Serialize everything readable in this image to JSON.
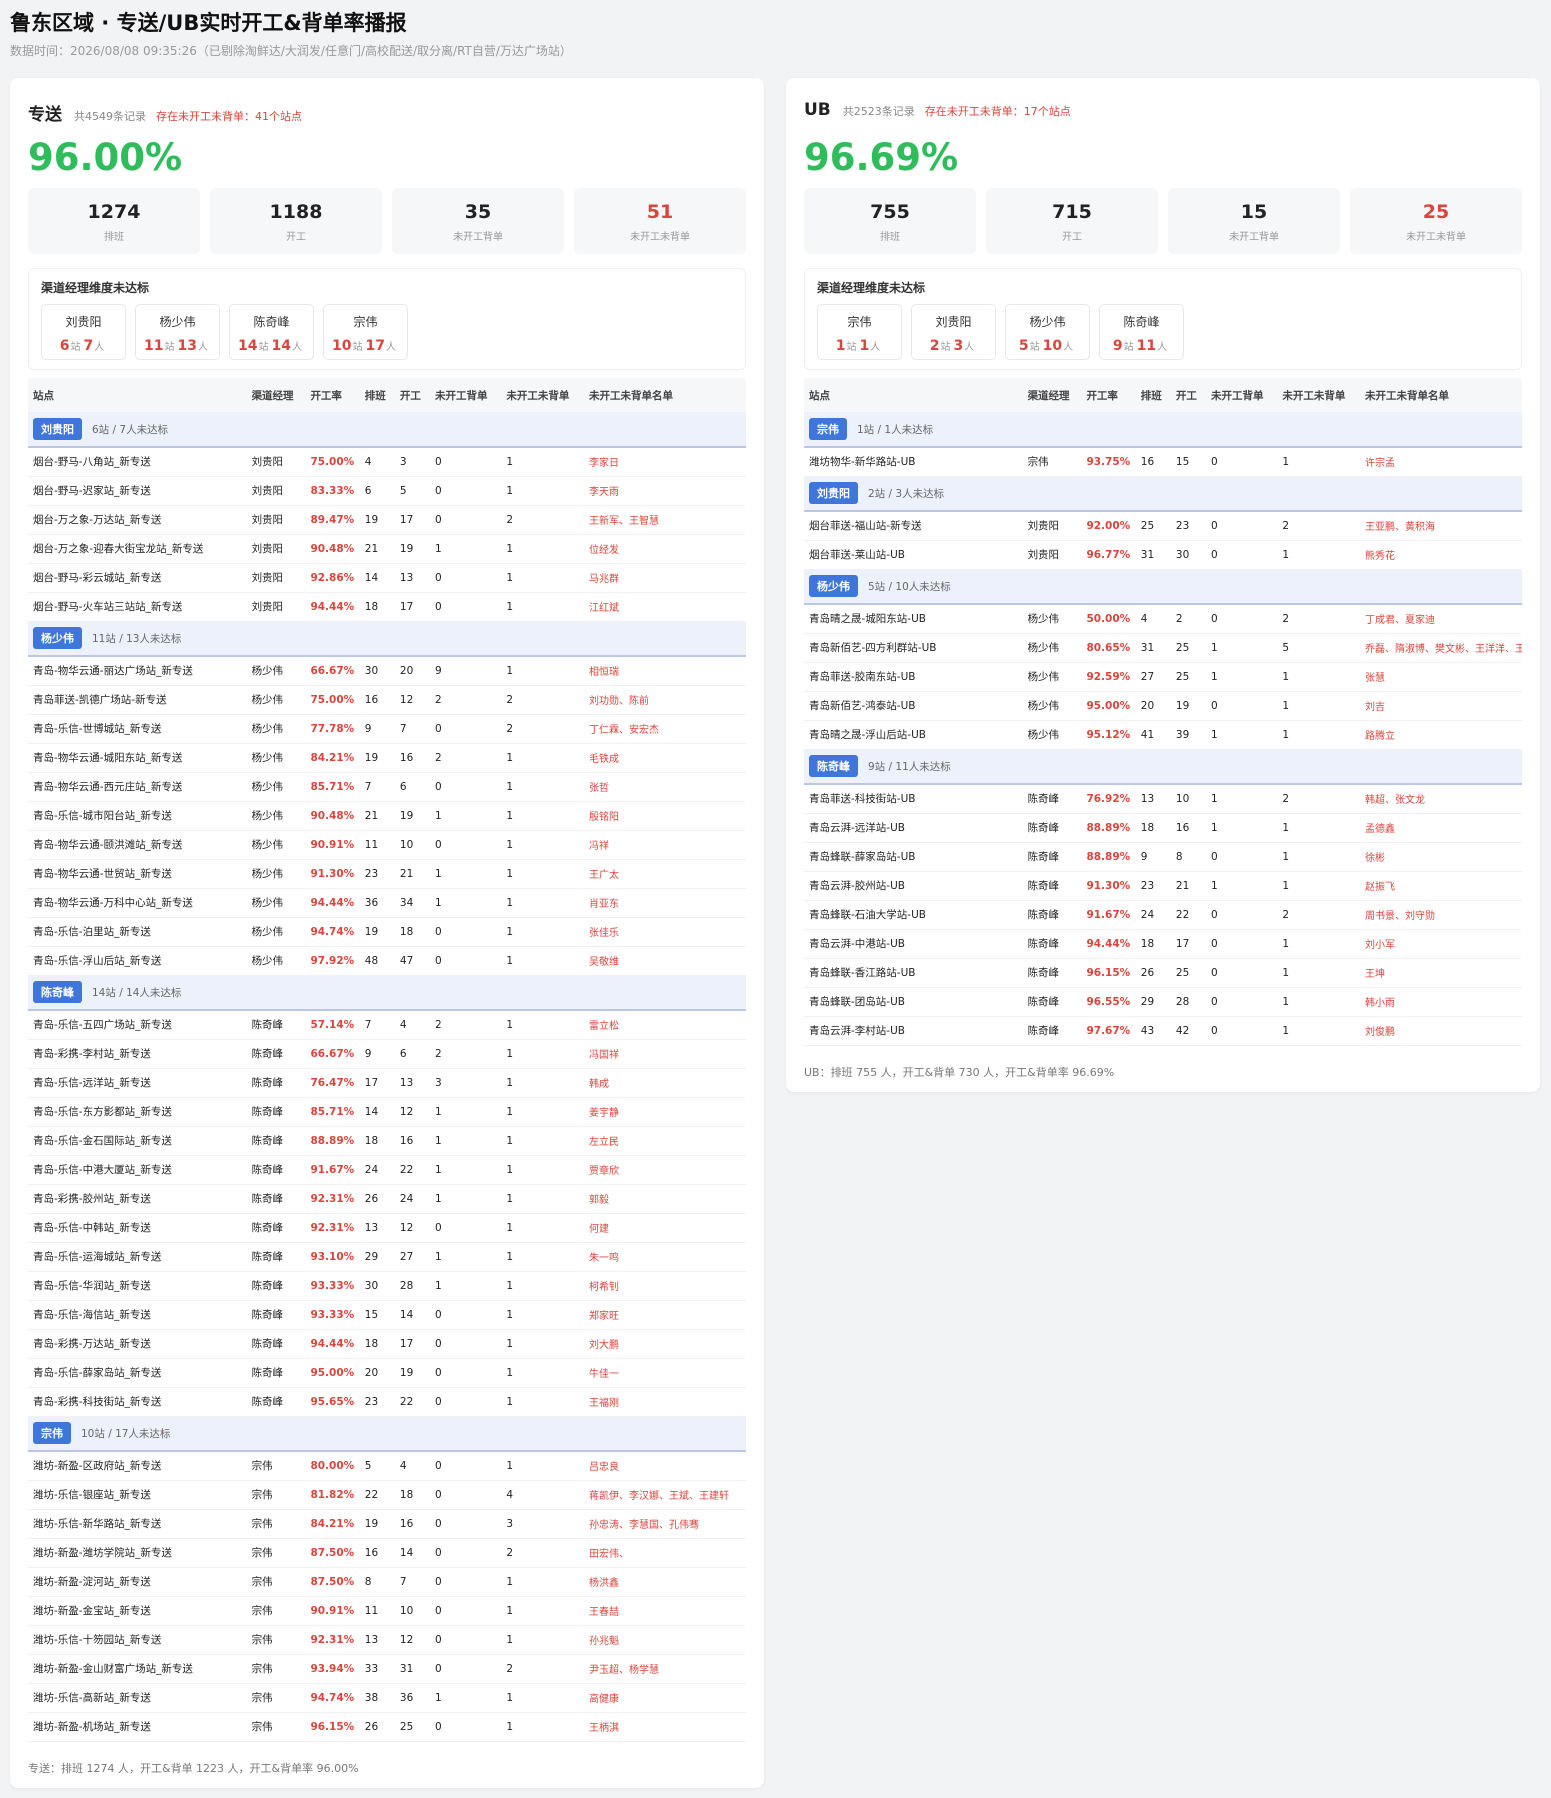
{
  "page": {
    "title": "鲁东区域 · 专送/UB实时开工&背单率播报",
    "subtitle": "数据时间：2026/08/08 09:35:26（已剔除淘鲜达/大润发/任意门/高校配送/取分离/RT自营/万达广场站）"
  },
  "columns": [
    "站点",
    "渠道经理",
    "开工率",
    "排班",
    "开工",
    "未开工背单",
    "未开工未背单",
    "未开工未背单名单"
  ],
  "mgr_box_title": "渠道经理维度未达标",
  "unit_station": "站",
  "unit_person": "人",
  "colors": {
    "accent": "#2fbc5a",
    "warn": "#d9453c",
    "tag": "#3f76d9"
  },
  "zs": {
    "name": "专送",
    "count": "共4549条记录",
    "warn": "存在未开工未背单：41个站点",
    "rate": "96.00%",
    "stats": [
      {
        "value": "1274",
        "label": "排班"
      },
      {
        "value": "1188",
        "label": "开工"
      },
      {
        "value": "35",
        "label": "未开工背单"
      },
      {
        "value": "51",
        "label": "未开工未背单"
      }
    ],
    "managers": [
      {
        "name": "刘贵阳",
        "stations": "6",
        "people": "7"
      },
      {
        "name": "杨少伟",
        "stations": "11",
        "people": "13"
      },
      {
        "name": "陈奇峰",
        "stations": "14",
        "people": "14"
      },
      {
        "name": "宗伟",
        "stations": "10",
        "people": "17"
      }
    ],
    "groups": [
      {
        "name": "刘贵阳",
        "info": "6站 / 7人未达标",
        "rows": [
          [
            "烟台-野马-八角站_新专送",
            "刘贵阳",
            "75.00%",
            "4",
            "3",
            "0",
            "1",
            "李家日"
          ],
          [
            "烟台-野马-迟家站_新专送",
            "刘贵阳",
            "83.33%",
            "6",
            "5",
            "0",
            "1",
            "李天雨"
          ],
          [
            "烟台-万之象-万达站_新专送",
            "刘贵阳",
            "89.47%",
            "19",
            "17",
            "0",
            "2",
            "王新军、王智慧"
          ],
          [
            "烟台-万之象-迎春大街宝龙站_新专送",
            "刘贵阳",
            "90.48%",
            "21",
            "19",
            "1",
            "1",
            "位经发"
          ],
          [
            "烟台-野马-彩云城站_新专送",
            "刘贵阳",
            "92.86%",
            "14",
            "13",
            "0",
            "1",
            "马兆群"
          ],
          [
            "烟台-野马-火车站三站站_新专送",
            "刘贵阳",
            "94.44%",
            "18",
            "17",
            "0",
            "1",
            "江红斌"
          ]
        ]
      },
      {
        "name": "杨少伟",
        "info": "11站 / 13人未达标",
        "rows": [
          [
            "青岛-物华云通-丽达广场站_新专送",
            "杨少伟",
            "66.67%",
            "30",
            "20",
            "9",
            "1",
            "相恒瑞"
          ],
          [
            "青岛菲送-凯德广场站-新专送",
            "杨少伟",
            "75.00%",
            "16",
            "12",
            "2",
            "2",
            "刘功勋、陈前"
          ],
          [
            "青岛-乐信-世博城站_新专送",
            "杨少伟",
            "77.78%",
            "9",
            "7",
            "0",
            "2",
            "丁仁霖、安宏杰"
          ],
          [
            "青岛-物华云通-城阳东站_新专送",
            "杨少伟",
            "84.21%",
            "19",
            "16",
            "2",
            "1",
            "毛铁成"
          ],
          [
            "青岛-物华云通-西元庄站_新专送",
            "杨少伟",
            "85.71%",
            "7",
            "6",
            "0",
            "1",
            "张哲"
          ],
          [
            "青岛-乐信-城市阳台站_新专送",
            "杨少伟",
            "90.48%",
            "21",
            "19",
            "1",
            "1",
            "殷铭阳"
          ],
          [
            "青岛-物华云通-颐洪滩站_新专送",
            "杨少伟",
            "90.91%",
            "11",
            "10",
            "0",
            "1",
            "冯祥"
          ],
          [
            "青岛-物华云通-世贸站_新专送",
            "杨少伟",
            "91.30%",
            "23",
            "21",
            "1",
            "1",
            "王广太"
          ],
          [
            "青岛-物华云通-万科中心站_新专送",
            "杨少伟",
            "94.44%",
            "36",
            "34",
            "1",
            "1",
            "肖亚东"
          ],
          [
            "青岛-乐信-泊里站_新专送",
            "杨少伟",
            "94.74%",
            "19",
            "18",
            "0",
            "1",
            "张佳乐"
          ],
          [
            "青岛-乐信-浮山后站_新专送",
            "杨少伟",
            "97.92%",
            "48",
            "47",
            "0",
            "1",
            "吴敬维"
          ]
        ]
      },
      {
        "name": "陈奇峰",
        "info": "14站 / 14人未达标",
        "rows": [
          [
            "青岛-乐信-五四广场站_新专送",
            "陈奇峰",
            "57.14%",
            "7",
            "4",
            "2",
            "1",
            "雷立松"
          ],
          [
            "青岛-彩携-李村站_新专送",
            "陈奇峰",
            "66.67%",
            "9",
            "6",
            "2",
            "1",
            "冯国祥"
          ],
          [
            "青岛-乐信-远洋站_新专送",
            "陈奇峰",
            "76.47%",
            "17",
            "13",
            "3",
            "1",
            "韩成"
          ],
          [
            "青岛-乐信-东方影都站_新专送",
            "陈奇峰",
            "85.71%",
            "14",
            "12",
            "1",
            "1",
            "姜宇静"
          ],
          [
            "青岛-乐信-金石国际站_新专送",
            "陈奇峰",
            "88.89%",
            "18",
            "16",
            "1",
            "1",
            "左立民"
          ],
          [
            "青岛-乐信-中港大厦站_新专送",
            "陈奇峰",
            "91.67%",
            "24",
            "22",
            "1",
            "1",
            "贾章欣"
          ],
          [
            "青岛-彩携-胶州站_新专送",
            "陈奇峰",
            "92.31%",
            "26",
            "24",
            "1",
            "1",
            "郭毅"
          ],
          [
            "青岛-乐信-中韩站_新专送",
            "陈奇峰",
            "92.31%",
            "13",
            "12",
            "0",
            "1",
            "何建"
          ],
          [
            "青岛-乐信-运海城站_新专送",
            "陈奇峰",
            "93.10%",
            "29",
            "27",
            "1",
            "1",
            "朱一鸣"
          ],
          [
            "青岛-乐信-华润站_新专送",
            "陈奇峰",
            "93.33%",
            "30",
            "28",
            "1",
            "1",
            "柯希钊"
          ],
          [
            "青岛-乐信-海信站_新专送",
            "陈奇峰",
            "93.33%",
            "15",
            "14",
            "0",
            "1",
            "郑家旺"
          ],
          [
            "青岛-彩携-万达站_新专送",
            "陈奇峰",
            "94.44%",
            "18",
            "17",
            "0",
            "1",
            "刘大鹏"
          ],
          [
            "青岛-乐信-薛家岛站_新专送",
            "陈奇峰",
            "95.00%",
            "20",
            "19",
            "0",
            "1",
            "牛佳一"
          ],
          [
            "青岛-彩携-科技街站_新专送",
            "陈奇峰",
            "95.65%",
            "23",
            "22",
            "0",
            "1",
            "王福刚"
          ]
        ]
      },
      {
        "name": "宗伟",
        "info": "10站 / 17人未达标",
        "rows": [
          [
            "潍坊-新盈-区政府站_新专送",
            "宗伟",
            "80.00%",
            "5",
            "4",
            "0",
            "1",
            "吕忠良"
          ],
          [
            "潍坊-乐信-银座站_新专送",
            "宗伟",
            "81.82%",
            "22",
            "18",
            "0",
            "4",
            "蒋凯伊、李汉娜、王斌、王建轩"
          ],
          [
            "潍坊-乐信-新华路站_新专送",
            "宗伟",
            "84.21%",
            "19",
            "16",
            "0",
            "3",
            "孙忠涛、李慧国、孔伟骞"
          ],
          [
            "潍坊-新盈-潍坊学院站_新专送",
            "宗伟",
            "87.50%",
            "16",
            "14",
            "0",
            "2",
            "田宏伟、"
          ],
          [
            "潍坊-新盈-淀河站_新专送",
            "宗伟",
            "87.50%",
            "8",
            "7",
            "0",
            "1",
            "杨洪鑫"
          ],
          [
            "潍坊-新盈-金宝站_新专送",
            "宗伟",
            "90.91%",
            "11",
            "10",
            "0",
            "1",
            "王春喆"
          ],
          [
            "潍坊-乐信-十笏园站_新专送",
            "宗伟",
            "92.31%",
            "13",
            "12",
            "0",
            "1",
            "孙兆魁"
          ],
          [
            "潍坊-新盈-金山财富广场站_新专送",
            "宗伟",
            "93.94%",
            "33",
            "31",
            "0",
            "2",
            "尹玉超、杨学慧"
          ],
          [
            "潍坊-乐信-高新站_新专送",
            "宗伟",
            "94.74%",
            "38",
            "36",
            "1",
            "1",
            "高健康"
          ],
          [
            "潍坊-新盈-机场站_新专送",
            "宗伟",
            "96.15%",
            "26",
            "25",
            "0",
            "1",
            "王柄淇"
          ]
        ]
      }
    ],
    "footer": "专送：排班 1274 人，开工&背单 1223 人，开工&背单率 96.00%"
  },
  "ub": {
    "name": "UB",
    "count": "共2523条记录",
    "warn": "存在未开工未背单：17个站点",
    "rate": "96.69%",
    "stats": [
      {
        "value": "755",
        "label": "排班"
      },
      {
        "value": "715",
        "label": "开工"
      },
      {
        "value": "15",
        "label": "未开工背单"
      },
      {
        "value": "25",
        "label": "未开工未背单"
      }
    ],
    "managers": [
      {
        "name": "宗伟",
        "stations": "1",
        "people": "1"
      },
      {
        "name": "刘贵阳",
        "stations": "2",
        "people": "3"
      },
      {
        "name": "杨少伟",
        "stations": "5",
        "people": "10"
      },
      {
        "name": "陈奇峰",
        "stations": "9",
        "people": "11"
      }
    ],
    "groups": [
      {
        "name": "宗伟",
        "info": "1站 / 1人未达标",
        "rows": [
          [
            "潍坊物华-新华路站-UB",
            "宗伟",
            "93.75%",
            "16",
            "15",
            "0",
            "1",
            "许宗孟"
          ]
        ]
      },
      {
        "name": "刘贵阳",
        "info": "2站 / 3人未达标",
        "rows": [
          [
            "烟台菲送-福山站-新专送",
            "刘贵阳",
            "92.00%",
            "25",
            "23",
            "0",
            "2",
            "王亚鹏、黄积海"
          ],
          [
            "烟台菲送-莱山站-UB",
            "刘贵阳",
            "96.77%",
            "31",
            "30",
            "0",
            "1",
            "熊秀花"
          ]
        ]
      },
      {
        "name": "杨少伟",
        "info": "5站 / 10人未达标",
        "rows": [
          [
            "青岛晴之晟-城阳东站-UB",
            "杨少伟",
            "50.00%",
            "4",
            "2",
            "0",
            "2",
            "丁成君、夏家迪"
          ],
          [
            "青岛新佰艺-四方利群站-UB",
            "杨少伟",
            "80.65%",
            "31",
            "25",
            "1",
            "5",
            "乔磊、隋淑博、樊文彬、王洋洋、王留达"
          ],
          [
            "青岛菲送-胶南东站-UB",
            "杨少伟",
            "92.59%",
            "27",
            "25",
            "1",
            "1",
            "张慧"
          ],
          [
            "青岛新佰艺-鸿泰站-UB",
            "杨少伟",
            "95.00%",
            "20",
            "19",
            "0",
            "1",
            "刘吉"
          ],
          [
            "青岛晴之晟-浮山后站-UB",
            "杨少伟",
            "95.12%",
            "41",
            "39",
            "1",
            "1",
            "路腾立"
          ]
        ]
      },
      {
        "name": "陈奇峰",
        "info": "9站 / 11人未达标",
        "rows": [
          [
            "青岛菲送-科技街站-UB",
            "陈奇峰",
            "76.92%",
            "13",
            "10",
            "1",
            "2",
            "韩超、张文龙"
          ],
          [
            "青岛云湃-远洋站-UB",
            "陈奇峰",
            "88.89%",
            "18",
            "16",
            "1",
            "1",
            "孟德鑫"
          ],
          [
            "青岛蜂联-薛家岛站-UB",
            "陈奇峰",
            "88.89%",
            "9",
            "8",
            "0",
            "1",
            "徐彬"
          ],
          [
            "青岛云湃-胶州站-UB",
            "陈奇峰",
            "91.30%",
            "23",
            "21",
            "1",
            "1",
            "赵振飞"
          ],
          [
            "青岛蜂联-石油大学站-UB",
            "陈奇峰",
            "91.67%",
            "24",
            "22",
            "0",
            "2",
            "周书景、刘守勋"
          ],
          [
            "青岛云湃-中港站-UB",
            "陈奇峰",
            "94.44%",
            "18",
            "17",
            "0",
            "1",
            "刘小军"
          ],
          [
            "青岛蜂联-香江路站-UB",
            "陈奇峰",
            "96.15%",
            "26",
            "25",
            "0",
            "1",
            "王坤"
          ],
          [
            "青岛蜂联-团岛站-UB",
            "陈奇峰",
            "96.55%",
            "29",
            "28",
            "0",
            "1",
            "韩小雨"
          ],
          [
            "青岛云湃-李村站-UB",
            "陈奇峰",
            "97.67%",
            "43",
            "42",
            "0",
            "1",
            "刘俊鹏"
          ]
        ]
      }
    ],
    "footer": "UB：排班 755 人，开工&背单 730 人，开工&背单率 96.69%"
  }
}
